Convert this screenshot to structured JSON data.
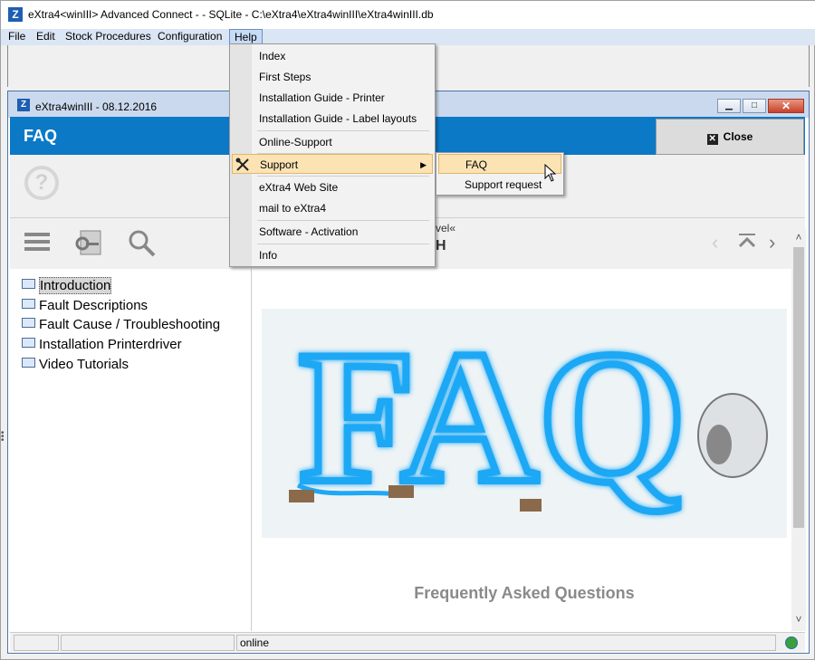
{
  "window": {
    "title": "eXtra4<winIII> Advanced Connect -  - SQLite  - C:\\eXtra4\\eXtra4winIII\\eXtra4winIII.db"
  },
  "menubar": {
    "items": [
      "File",
      "Edit",
      "Stock Procedures",
      "Configuration",
      "Help"
    ]
  },
  "child_window": {
    "title": "eXtra4winIII  -  08.12.2016",
    "buttons": [
      "minimize",
      "maximize",
      "close"
    ]
  },
  "header": {
    "title": "FAQ",
    "close_label": "Close"
  },
  "topic": {
    "label": "vel«",
    "title": "H"
  },
  "tree": {
    "items": [
      {
        "label": "Introduction",
        "icon": "book-open-icon"
      },
      {
        "label": "Fault Descriptions",
        "icon": "book-closed-icon"
      },
      {
        "label": "Fault Cause / Troubleshooting",
        "icon": "book-closed-icon"
      },
      {
        "label": "Installation Printerdriver",
        "icon": "book-closed-icon"
      },
      {
        "label": "Video Tutorials",
        "icon": "book-open-icon"
      }
    ]
  },
  "content": {
    "image_text": "FAQ",
    "subtitle": "Frequently Asked Questions"
  },
  "status": {
    "connection": "online"
  },
  "help_menu": {
    "items": [
      "Index",
      "First Steps",
      "Installation Guide - Printer",
      "Installation Guide - Label layouts",
      "Online-Support",
      "Support",
      "eXtra4 Web Site",
      "mail to eXtra4",
      "Software - Activation",
      "Info"
    ],
    "highlighted": "Support"
  },
  "support_submenu": {
    "items": [
      "FAQ",
      "Support request"
    ],
    "highlighted": "FAQ"
  },
  "colors": {
    "header_blue": "#0b79c6",
    "menu_highlight": "#fbe3b4",
    "faq_neon": "#1ea8f5"
  }
}
